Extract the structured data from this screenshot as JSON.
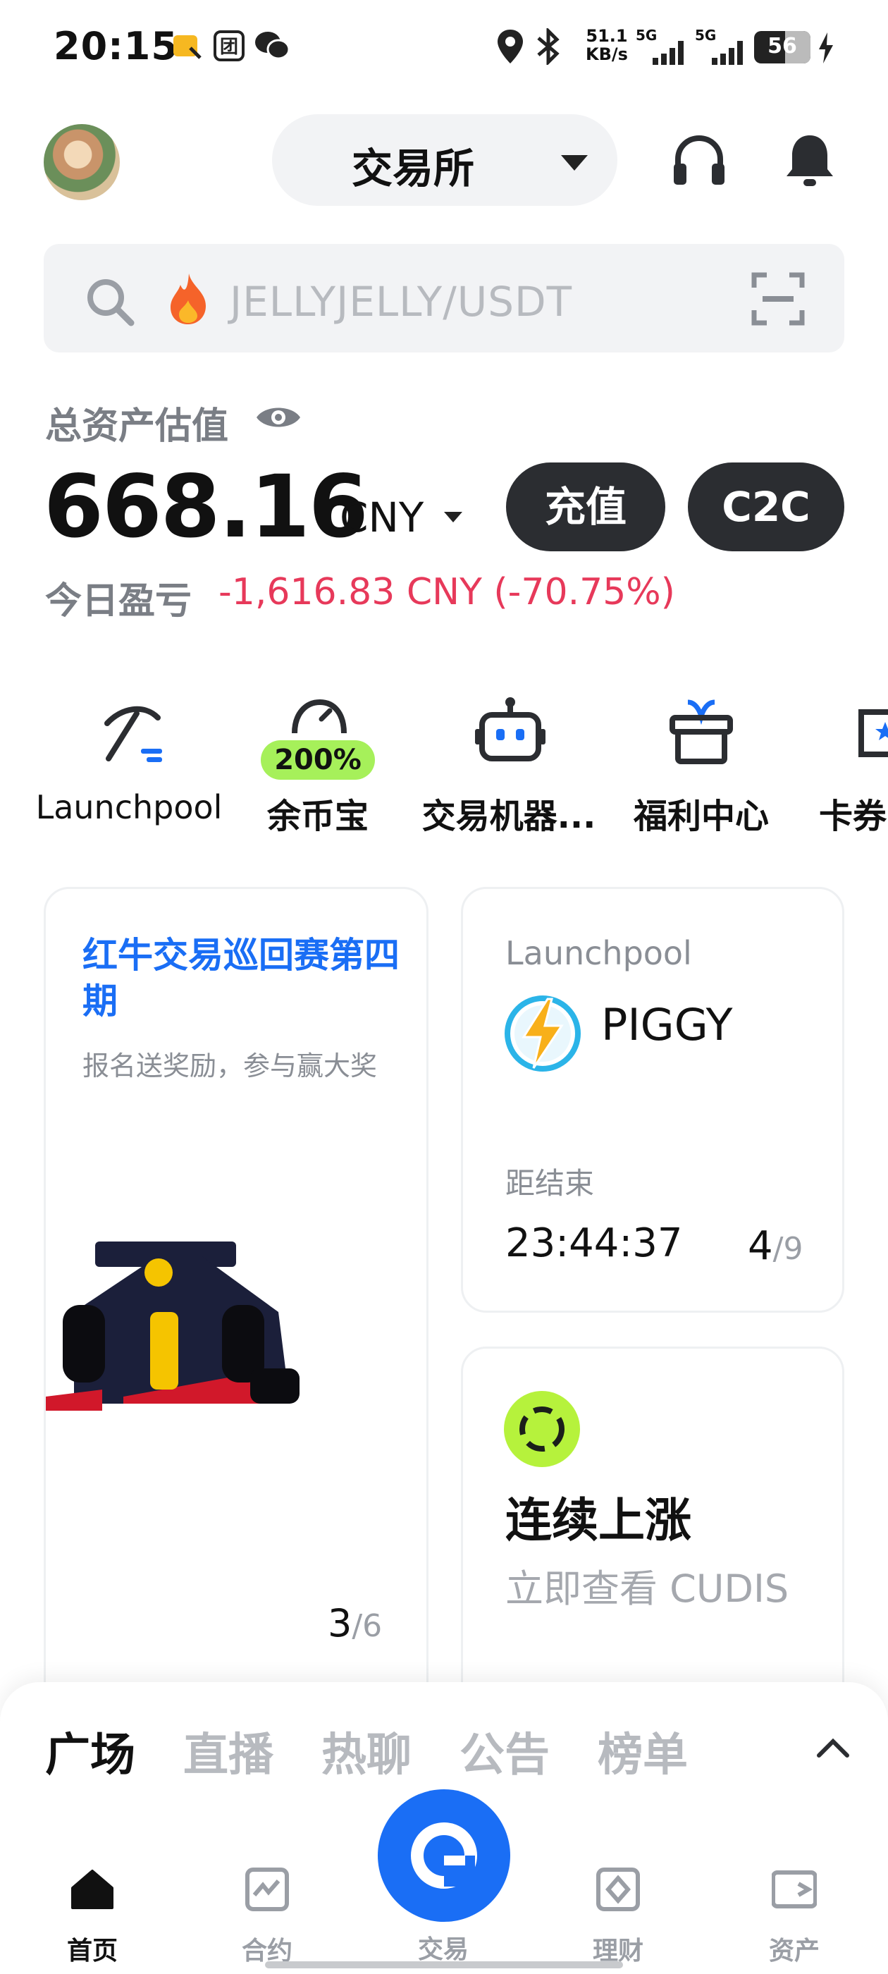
{
  "status_bar": {
    "time": "20:15",
    "net_speed_top": "51.1",
    "net_speed_bottom": "KB/s",
    "signal1": "5G",
    "signal2": "5G",
    "battery": "56"
  },
  "header": {
    "exchange_label": "交易所"
  },
  "search": {
    "placeholder": "JELLYJELLY/USDT"
  },
  "assets": {
    "title": "总资产估值",
    "value": "668.16",
    "unit": "CNY",
    "deposit_label": "充值",
    "c2c_label": "C2C",
    "pnl_label": "今日盈亏",
    "pnl_value": "-1,616.83 CNY (-70.75%)"
  },
  "quick_actions": [
    {
      "label": "Launchpool",
      "icon": "pickaxe-icon"
    },
    {
      "label": "余币宝",
      "icon": "piggy-icon",
      "badge": "200%"
    },
    {
      "label": "交易机器...",
      "icon": "robot-icon"
    },
    {
      "label": "福利中心",
      "icon": "gift-icon"
    },
    {
      "label": "卡券",
      "icon": "coupon-icon"
    }
  ],
  "promo_card": {
    "title": "红牛交易巡回赛第四期",
    "subtitle": "报名送奖励，参与赢大奖",
    "page_current": "3",
    "page_total": "/6"
  },
  "launchpool_card": {
    "tag": "Launchpool",
    "token": "PIGGY",
    "end_label": "距结束",
    "timer": "23:44:37",
    "page_current": "4",
    "page_total": "/9"
  },
  "streak_card": {
    "title": "连续上涨",
    "subtitle": "立即查看 CUDIS"
  },
  "feed_tabs": [
    "广场",
    "直播",
    "热聊",
    "公告",
    "榜单"
  ],
  "bottom_nav": {
    "home": "首页",
    "futures": "合约",
    "trade": "交易",
    "earn": "理财",
    "assets": "资产"
  },
  "colors": {
    "accent": "#1a6ef5",
    "loss": "#e7395a",
    "badge_green": "#a6f05a"
  }
}
